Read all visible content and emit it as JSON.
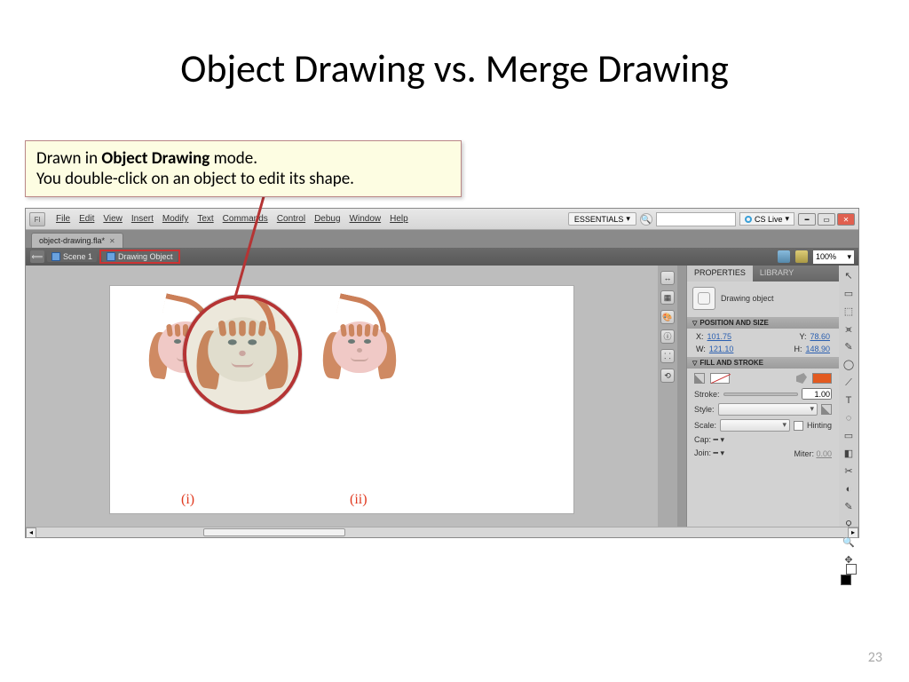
{
  "slide": {
    "title": "Object Drawing vs. Merge Drawing",
    "page_number": "23"
  },
  "callout": {
    "line1_pre": "Drawn in ",
    "line1_bold": "Object Drawing",
    "line1_post": " mode.",
    "line2": "You double-click on an object to edit its shape."
  },
  "menubar": {
    "logo": "Fl",
    "items": [
      "File",
      "Edit",
      "View",
      "Insert",
      "Modify",
      "Text",
      "Commands",
      "Control",
      "Debug",
      "Window",
      "Help"
    ],
    "workspace": "ESSENTIALS",
    "cslive": "CS Live"
  },
  "tabs": {
    "file_tab": "object-drawing.fla*"
  },
  "editbar": {
    "scene": "Scene 1",
    "crumb": "Drawing Object",
    "zoom": "100%"
  },
  "stage": {
    "caption1": "(i)",
    "caption2": "(ii)"
  },
  "panel": {
    "tabs": [
      "PROPERTIES",
      "LIBRARY"
    ],
    "object_label": "Drawing object",
    "sec_position": "POSITION AND SIZE",
    "pos": {
      "x_label": "X:",
      "x": "101.75",
      "y_label": "Y:",
      "y": "78.60",
      "w_label": "W:",
      "w": "121.10",
      "h_label": "H:",
      "h": "148.90"
    },
    "sec_fill": "FILL AND STROKE",
    "stroke_label": "Stroke:",
    "stroke_val": "1.00",
    "style_label": "Style:",
    "scale_label": "Scale:",
    "hinting_label": "Hinting",
    "cap_label": "Cap:",
    "join_label": "Join:",
    "miter_label": "Miter:",
    "miter_val": "0.00"
  },
  "left_strip_icons": [
    "↔",
    "▦",
    "🎨",
    "ⓘ",
    "⸬",
    "⟲"
  ],
  "tool_icons": [
    "↖",
    "▭",
    "⬚",
    "⪤",
    "✎",
    "◯",
    "⟋",
    "T",
    "◌",
    "▭",
    "◧",
    "✂",
    "◐",
    "✎",
    "⚲",
    "🔍",
    "✥",
    "🖐"
  ]
}
